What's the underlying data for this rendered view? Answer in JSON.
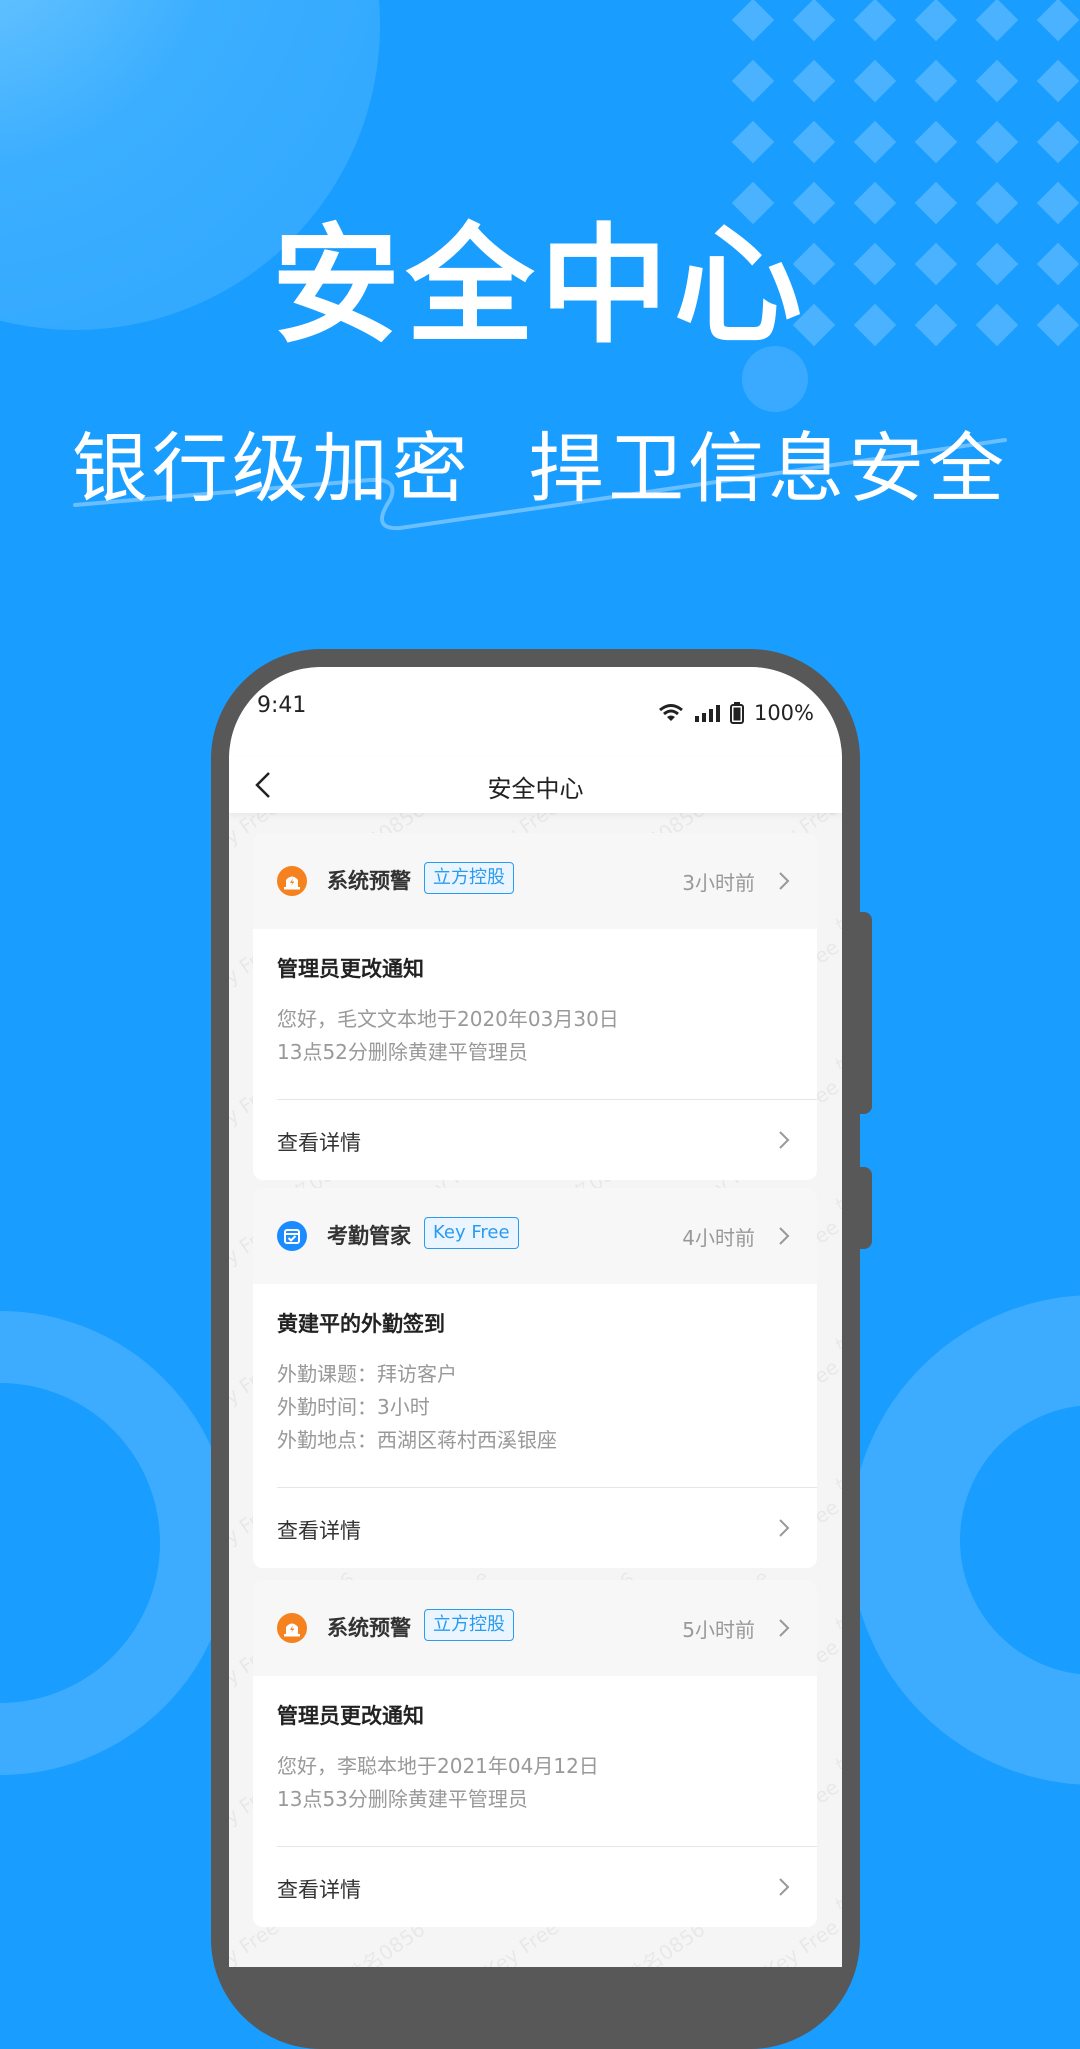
{
  "hero": {
    "title": "安全中心",
    "subtitle": "银行级加密  捍卫信息安全"
  },
  "colors": {
    "background": "#199dff",
    "accent": "#2b9bf0",
    "alert_orange": "#f5821f",
    "attendance_blue": "#1a8cff"
  },
  "status_bar": {
    "time": "9:41",
    "wifi_icon": "wifi-icon",
    "signal_icon": "signal-icon",
    "battery_icon": "battery-icon",
    "battery": "100%"
  },
  "nav": {
    "back_icon": "chevron-left-icon",
    "title": "安全中心"
  },
  "watermark": [
    "姓名0856",
    "Key Free"
  ],
  "cards": [
    {
      "icon": "alarm-icon",
      "app_name": "系统预警",
      "tag": "立方控股",
      "time_ago": "3小时前",
      "title": "管理员更改通知",
      "lines": [
        "您好，毛文文本地于2020年03月30日",
        "13点52分删除黄建平管理员"
      ],
      "detail_label": "查看详情"
    },
    {
      "icon": "calendar-check-icon",
      "app_name": "考勤管家",
      "tag": "Key Free",
      "time_ago": "4小时前",
      "title": "黄建平的外勤签到",
      "lines": [
        "外勤课题：拜访客户",
        "外勤时间：3小时",
        "外勤地点：西湖区蒋村西溪银座"
      ],
      "detail_label": "查看详情"
    },
    {
      "icon": "alarm-icon",
      "app_name": "系统预警",
      "tag": "立方控股",
      "time_ago": "5小时前",
      "title": "管理员更改通知",
      "lines": [
        "您好，李聪本地于2021年04月12日",
        "13点53分删除黄建平管理员"
      ],
      "detail_label": "查看详情"
    }
  ]
}
